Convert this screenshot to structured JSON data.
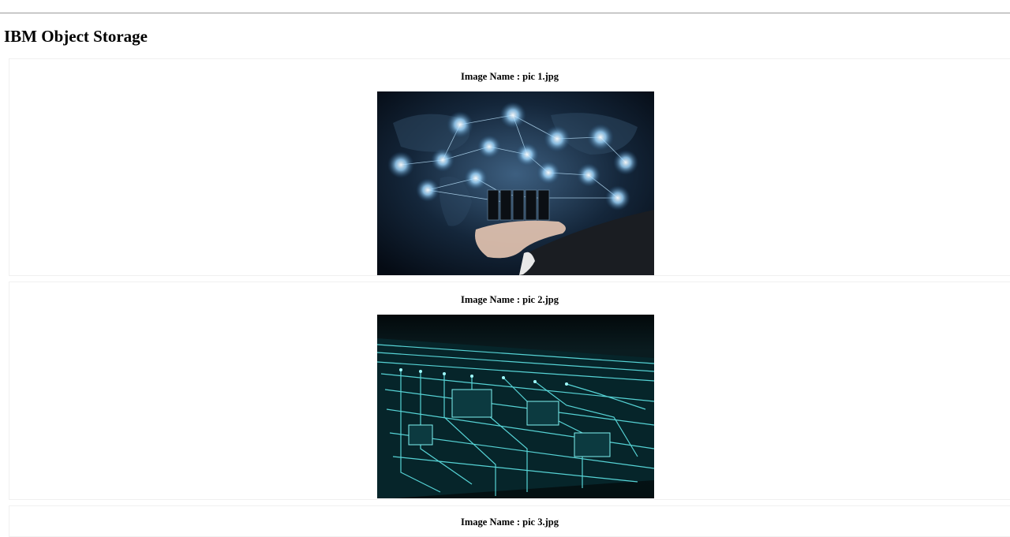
{
  "page": {
    "title": "IBM Object Storage"
  },
  "images": [
    {
      "label": "Image Name : pic 1.jpg",
      "picture": "network-cloud-hand-photo"
    },
    {
      "label": "Image Name : pic 2.jpg",
      "picture": "circuit-board-photo"
    },
    {
      "label": "Image Name : pic 3.jpg"
    }
  ],
  "colors": {
    "background": "#ffffff",
    "card_border": "#f0f0f0",
    "rule": "#9a9a9a"
  }
}
